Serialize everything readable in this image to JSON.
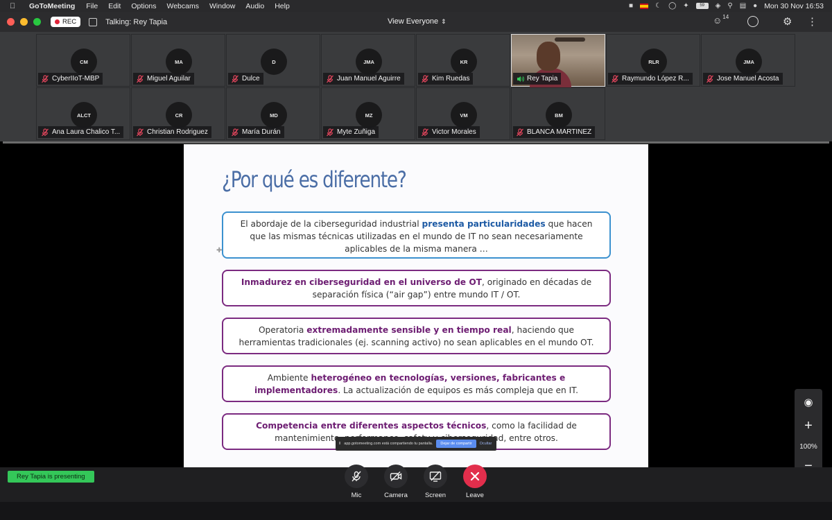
{
  "menubar": {
    "app_name": "GoToMeeting",
    "items": [
      "File",
      "Edit",
      "Options",
      "Webcams",
      "Window",
      "Audio",
      "Help"
    ],
    "battery": "59",
    "datetime": "Mon 30 Nov  16:53"
  },
  "titlebar": {
    "rec_label": "REC",
    "talking": "Talking: Rey Tapia",
    "view_label": "View Everyone",
    "attendee_count": "14"
  },
  "participants": [
    {
      "initials": "CM",
      "name": "CyberIIoT-MBP"
    },
    {
      "initials": "MA",
      "name": "Miguel Aguilar"
    },
    {
      "initials": "D",
      "name": "Dulce"
    },
    {
      "initials": "JMA",
      "name": "Juan Manuel Aguirre"
    },
    {
      "initials": "KR",
      "name": "Kim Ruedas"
    },
    {
      "initials": "",
      "name": "Rey Tapia"
    },
    {
      "initials": "RLR",
      "name": "Raymundo López R..."
    },
    {
      "initials": "JMA",
      "name": "Jose Manuel Acosta"
    },
    {
      "initials": "ALCT",
      "name": "Ana Laura Chalico T..."
    },
    {
      "initials": "CR",
      "name": "Christian Rodriguez"
    },
    {
      "initials": "MD",
      "name": "María Durán"
    },
    {
      "initials": "MZ",
      "name": "Myte Zuñiga"
    },
    {
      "initials": "VM",
      "name": "Victor Morales"
    },
    {
      "initials": "BM",
      "name": "BLANCA MARTINEZ"
    }
  ],
  "slide": {
    "title": "¿Por qué es diferente?",
    "box1": {
      "pre": "El abordaje de la ciberseguridad industrial ",
      "hl": "presenta particularidades",
      "post": " que hacen que las mismas técnicas utilizadas en el mundo de IT no sean necesariamente aplicables de la misma manera …"
    },
    "box2": {
      "pre": "",
      "hl": "Inmadurez en ciberseguridad en el universo de OT",
      "post": ", originado en décadas de separación física (“air gap”) entre mundo IT / OT."
    },
    "box3": {
      "pre": "Operatoria ",
      "hl": "extremadamente sensible y en tiempo real",
      "post": ", haciendo que herramientas tradicionales (ej. scanning activo) no sean aplicables en el mundo OT."
    },
    "box4": {
      "pre": "Ambiente ",
      "hl": "heterogéneo en tecnologías, versiones, fabricantes e implementadores",
      "post": ". La actualización de equipos es más compleja que en IT."
    },
    "box5": {
      "pre": "",
      "hl": "Competencia entre diferentes aspectos técnicos",
      "post": ", como la facilidad de mantenimiento, performance, safety y ciberseguridad, entre otros."
    }
  },
  "sharebar": {
    "text": "app.gotomeeting.com está compartiendo tu pantalla.",
    "stop": "Dejar de compartir",
    "hide": "Ocultar"
  },
  "zoom": {
    "level": "100%"
  },
  "bottom": {
    "presenting": "Rey Tapia is presenting",
    "mic": "Mic",
    "camera": "Camera",
    "screen": "Screen",
    "leave": "Leave"
  }
}
